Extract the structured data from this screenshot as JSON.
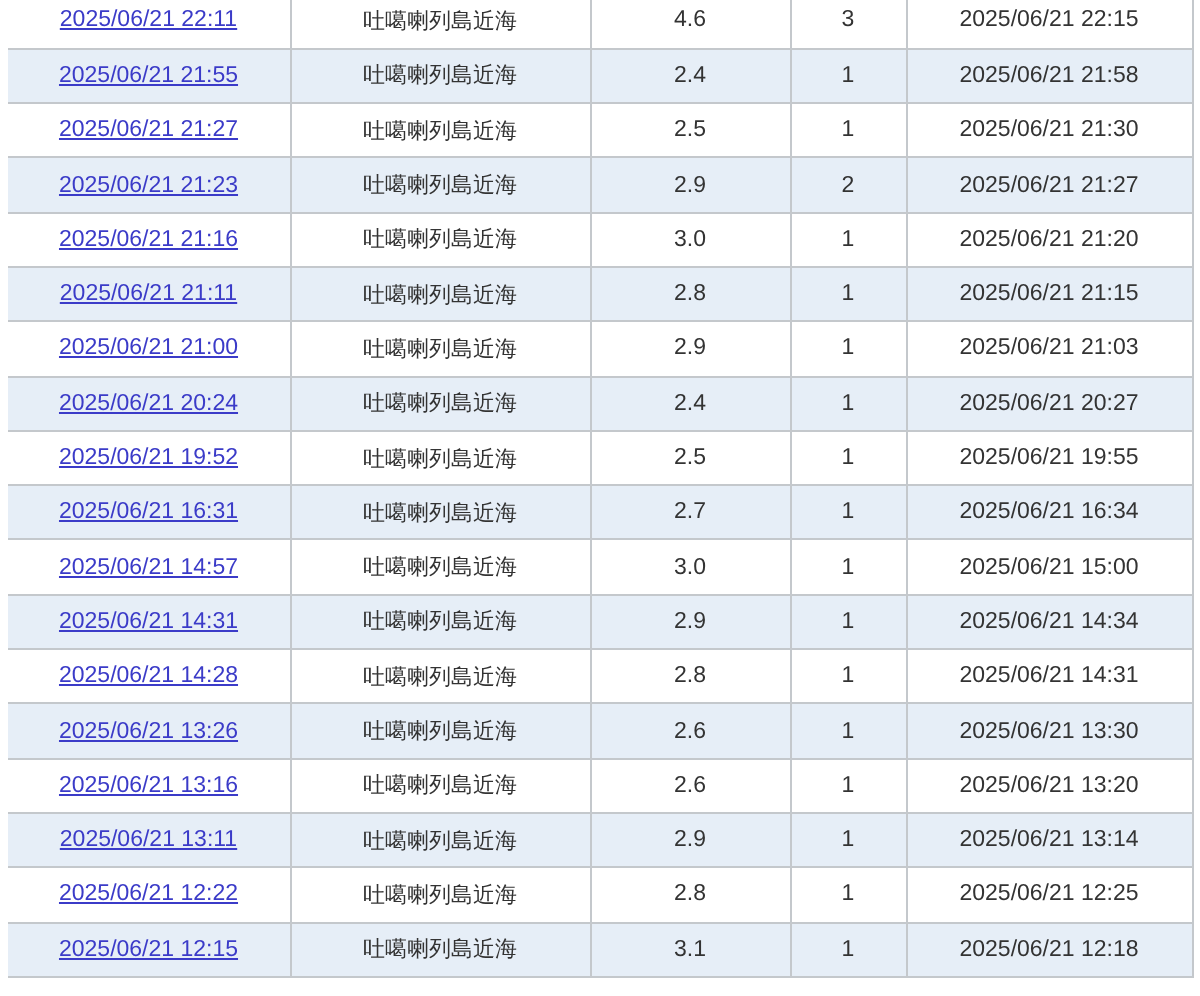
{
  "table": {
    "rows": [
      {
        "column_1": "2025/06/21 22:11",
        "column_2": "吐噶喇列島近海",
        "column_3": "4.6",
        "column_4": "3",
        "column_5": "2025/06/21 22:15"
      },
      {
        "column_1": "2025/06/21 21:55",
        "column_2": "吐噶喇列島近海",
        "column_3": "2.4",
        "column_4": "1",
        "column_5": "2025/06/21 21:58"
      },
      {
        "column_1": "2025/06/21 21:27",
        "column_2": "吐噶喇列島近海",
        "column_3": "2.5",
        "column_4": "1",
        "column_5": "2025/06/21 21:30"
      },
      {
        "column_1": "2025/06/21 21:23",
        "column_2": "吐噶喇列島近海",
        "column_3": "2.9",
        "column_4": "2",
        "column_5": "2025/06/21 21:27"
      },
      {
        "column_1": "2025/06/21 21:16",
        "column_2": "吐噶喇列島近海",
        "column_3": "3.0",
        "column_4": "1",
        "column_5": "2025/06/21 21:20"
      },
      {
        "column_1": "2025/06/21 21:11",
        "column_2": "吐噶喇列島近海",
        "column_3": "2.8",
        "column_4": "1",
        "column_5": "2025/06/21 21:15"
      },
      {
        "column_1": "2025/06/21 21:00",
        "column_2": "吐噶喇列島近海",
        "column_3": "2.9",
        "column_4": "1",
        "column_5": "2025/06/21 21:03"
      },
      {
        "column_1": "2025/06/21 20:24",
        "column_2": "吐噶喇列島近海",
        "column_3": "2.4",
        "column_4": "1",
        "column_5": "2025/06/21 20:27"
      },
      {
        "column_1": "2025/06/21 19:52",
        "column_2": "吐噶喇列島近海",
        "column_3": "2.5",
        "column_4": "1",
        "column_5": "2025/06/21 19:55"
      },
      {
        "column_1": "2025/06/21 16:31",
        "column_2": "吐噶喇列島近海",
        "column_3": "2.7",
        "column_4": "1",
        "column_5": "2025/06/21 16:34"
      },
      {
        "column_1": "2025/06/21 14:57",
        "column_2": "吐噶喇列島近海",
        "column_3": "3.0",
        "column_4": "1",
        "column_5": "2025/06/21 15:00"
      },
      {
        "column_1": "2025/06/21 14:31",
        "column_2": "吐噶喇列島近海",
        "column_3": "2.9",
        "column_4": "1",
        "column_5": "2025/06/21 14:34"
      },
      {
        "column_1": "2025/06/21 14:28",
        "column_2": "吐噶喇列島近海",
        "column_3": "2.8",
        "column_4": "1",
        "column_5": "2025/06/21 14:31"
      },
      {
        "column_1": "2025/06/21 13:26",
        "column_2": "吐噶喇列島近海",
        "column_3": "2.6",
        "column_4": "1",
        "column_5": "2025/06/21 13:30"
      },
      {
        "column_1": "2025/06/21 13:16",
        "column_2": "吐噶喇列島近海",
        "column_3": "2.6",
        "column_4": "1",
        "column_5": "2025/06/21 13:20"
      },
      {
        "column_1": "2025/06/21 13:11",
        "column_2": "吐噶喇列島近海",
        "column_3": "2.9",
        "column_4": "1",
        "column_5": "2025/06/21 13:14"
      },
      {
        "column_1": "2025/06/21 12:22",
        "column_2": "吐噶喇列島近海",
        "column_3": "2.8",
        "column_4": "1",
        "column_5": "2025/06/21 12:25"
      },
      {
        "column_1": "2025/06/21 12:15",
        "column_2": "吐噶喇列島近海",
        "column_3": "3.1",
        "column_4": "1",
        "column_5": "2025/06/21 12:18"
      }
    ]
  }
}
